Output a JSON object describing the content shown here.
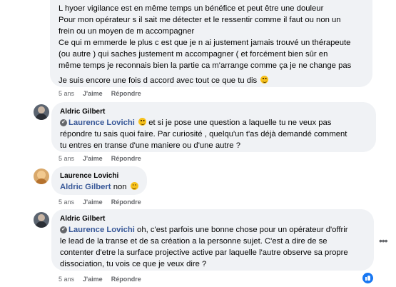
{
  "comments": [
    {
      "lines": [
        "L hyoer vigilance est en même temps un bénéfice et peut être une douleur",
        "Pour mon opérateur s il sait me détecter et le ressentir comme il faut ou non un",
        "frein ou un moyen de m accompagner",
        "Ce qui m emmerde le plus c est que je n ai justement jamais trouvé un thérapeute",
        "(ou autre ) qui saches justement m accompagner ( et forcément bien sûr en",
        "même temps je reconnais bien la partie ca m'arrange comme ça je ne change pas"
      ],
      "last_line": "Je suis encore une fois d accord avec tout ce que tu dis",
      "time": "5 ans",
      "like": "J'aime",
      "reply": "Répondre"
    },
    {
      "author": "Aldric Gilbert",
      "mention": "Laurence Lovichi",
      "first_line_rest": " et si je pose une question a laquelle tu ne veux pas",
      "lines": [
        "répondre tu sais quoi faire. Par curiosité , quelqu'un t'as déjà demandé comment",
        "tu entres en transe d'une maniere ou d'une autre ?"
      ],
      "time": "5 ans",
      "like": "J'aime",
      "reply": "Répondre"
    },
    {
      "author": "Laurence Lovichi",
      "mention": "Aldric Gilbert",
      "text": " non",
      "time": "5 ans",
      "like": "J'aime",
      "reply": "Répondre"
    },
    {
      "author": "Aldric Gilbert",
      "mention": "Laurence Lovichi",
      "first_line_rest": " oh, c'est parfois une bonne chose pour un opérateur d'offrir",
      "lines": [
        "le lead de la transe et de sa création a la personne sujet. C'est a dire de se",
        "contenter d'etre la surface projective active par laquelle l'autre observe sa propre",
        "dissociation, tu vois ce que je veux dire ?"
      ],
      "time": "5 ans",
      "like": "J'aime",
      "reply": "Répondre",
      "more": "•••"
    }
  ],
  "colors": {
    "bubble": "#f0f2f5",
    "mention": "#385898",
    "meta": "#65676b",
    "like_badge": "#1877f2"
  },
  "icons": {
    "emoji": "smiling-face-emoji",
    "like": "thumbs-up-icon",
    "more": "more-options-icon",
    "mention": "mention-user-icon"
  }
}
